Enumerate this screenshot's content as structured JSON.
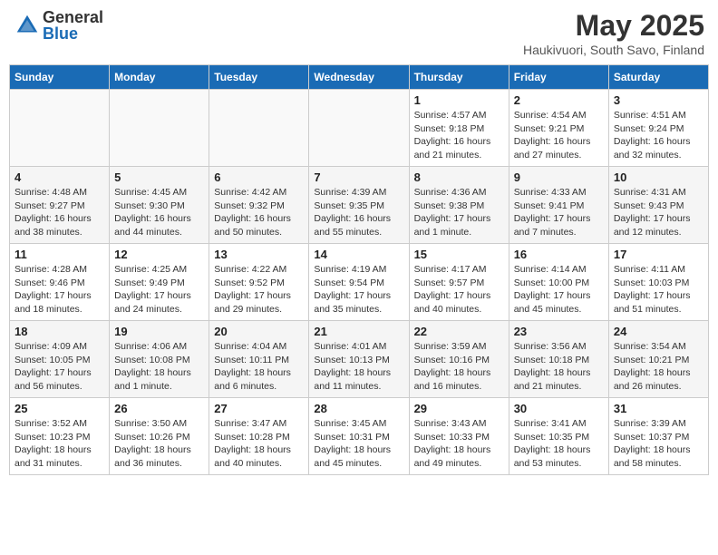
{
  "header": {
    "logo_general": "General",
    "logo_blue": "Blue",
    "month_title": "May 2025",
    "subtitle": "Haukivuori, South Savo, Finland"
  },
  "columns": [
    "Sunday",
    "Monday",
    "Tuesday",
    "Wednesday",
    "Thursday",
    "Friday",
    "Saturday"
  ],
  "weeks": [
    [
      {
        "day": "",
        "info": ""
      },
      {
        "day": "",
        "info": ""
      },
      {
        "day": "",
        "info": ""
      },
      {
        "day": "",
        "info": ""
      },
      {
        "day": "1",
        "info": "Sunrise: 4:57 AM\nSunset: 9:18 PM\nDaylight: 16 hours and 21 minutes."
      },
      {
        "day": "2",
        "info": "Sunrise: 4:54 AM\nSunset: 9:21 PM\nDaylight: 16 hours and 27 minutes."
      },
      {
        "day": "3",
        "info": "Sunrise: 4:51 AM\nSunset: 9:24 PM\nDaylight: 16 hours and 32 minutes."
      }
    ],
    [
      {
        "day": "4",
        "info": "Sunrise: 4:48 AM\nSunset: 9:27 PM\nDaylight: 16 hours and 38 minutes."
      },
      {
        "day": "5",
        "info": "Sunrise: 4:45 AM\nSunset: 9:30 PM\nDaylight: 16 hours and 44 minutes."
      },
      {
        "day": "6",
        "info": "Sunrise: 4:42 AM\nSunset: 9:32 PM\nDaylight: 16 hours and 50 minutes."
      },
      {
        "day": "7",
        "info": "Sunrise: 4:39 AM\nSunset: 9:35 PM\nDaylight: 16 hours and 55 minutes."
      },
      {
        "day": "8",
        "info": "Sunrise: 4:36 AM\nSunset: 9:38 PM\nDaylight: 17 hours and 1 minute."
      },
      {
        "day": "9",
        "info": "Sunrise: 4:33 AM\nSunset: 9:41 PM\nDaylight: 17 hours and 7 minutes."
      },
      {
        "day": "10",
        "info": "Sunrise: 4:31 AM\nSunset: 9:43 PM\nDaylight: 17 hours and 12 minutes."
      }
    ],
    [
      {
        "day": "11",
        "info": "Sunrise: 4:28 AM\nSunset: 9:46 PM\nDaylight: 17 hours and 18 minutes."
      },
      {
        "day": "12",
        "info": "Sunrise: 4:25 AM\nSunset: 9:49 PM\nDaylight: 17 hours and 24 minutes."
      },
      {
        "day": "13",
        "info": "Sunrise: 4:22 AM\nSunset: 9:52 PM\nDaylight: 17 hours and 29 minutes."
      },
      {
        "day": "14",
        "info": "Sunrise: 4:19 AM\nSunset: 9:54 PM\nDaylight: 17 hours and 35 minutes."
      },
      {
        "day": "15",
        "info": "Sunrise: 4:17 AM\nSunset: 9:57 PM\nDaylight: 17 hours and 40 minutes."
      },
      {
        "day": "16",
        "info": "Sunrise: 4:14 AM\nSunset: 10:00 PM\nDaylight: 17 hours and 45 minutes."
      },
      {
        "day": "17",
        "info": "Sunrise: 4:11 AM\nSunset: 10:03 PM\nDaylight: 17 hours and 51 minutes."
      }
    ],
    [
      {
        "day": "18",
        "info": "Sunrise: 4:09 AM\nSunset: 10:05 PM\nDaylight: 17 hours and 56 minutes."
      },
      {
        "day": "19",
        "info": "Sunrise: 4:06 AM\nSunset: 10:08 PM\nDaylight: 18 hours and 1 minute."
      },
      {
        "day": "20",
        "info": "Sunrise: 4:04 AM\nSunset: 10:11 PM\nDaylight: 18 hours and 6 minutes."
      },
      {
        "day": "21",
        "info": "Sunrise: 4:01 AM\nSunset: 10:13 PM\nDaylight: 18 hours and 11 minutes."
      },
      {
        "day": "22",
        "info": "Sunrise: 3:59 AM\nSunset: 10:16 PM\nDaylight: 18 hours and 16 minutes."
      },
      {
        "day": "23",
        "info": "Sunrise: 3:56 AM\nSunset: 10:18 PM\nDaylight: 18 hours and 21 minutes."
      },
      {
        "day": "24",
        "info": "Sunrise: 3:54 AM\nSunset: 10:21 PM\nDaylight: 18 hours and 26 minutes."
      }
    ],
    [
      {
        "day": "25",
        "info": "Sunrise: 3:52 AM\nSunset: 10:23 PM\nDaylight: 18 hours and 31 minutes."
      },
      {
        "day": "26",
        "info": "Sunrise: 3:50 AM\nSunset: 10:26 PM\nDaylight: 18 hours and 36 minutes."
      },
      {
        "day": "27",
        "info": "Sunrise: 3:47 AM\nSunset: 10:28 PM\nDaylight: 18 hours and 40 minutes."
      },
      {
        "day": "28",
        "info": "Sunrise: 3:45 AM\nSunset: 10:31 PM\nDaylight: 18 hours and 45 minutes."
      },
      {
        "day": "29",
        "info": "Sunrise: 3:43 AM\nSunset: 10:33 PM\nDaylight: 18 hours and 49 minutes."
      },
      {
        "day": "30",
        "info": "Sunrise: 3:41 AM\nSunset: 10:35 PM\nDaylight: 18 hours and 53 minutes."
      },
      {
        "day": "31",
        "info": "Sunrise: 3:39 AM\nSunset: 10:37 PM\nDaylight: 18 hours and 58 minutes."
      }
    ]
  ]
}
